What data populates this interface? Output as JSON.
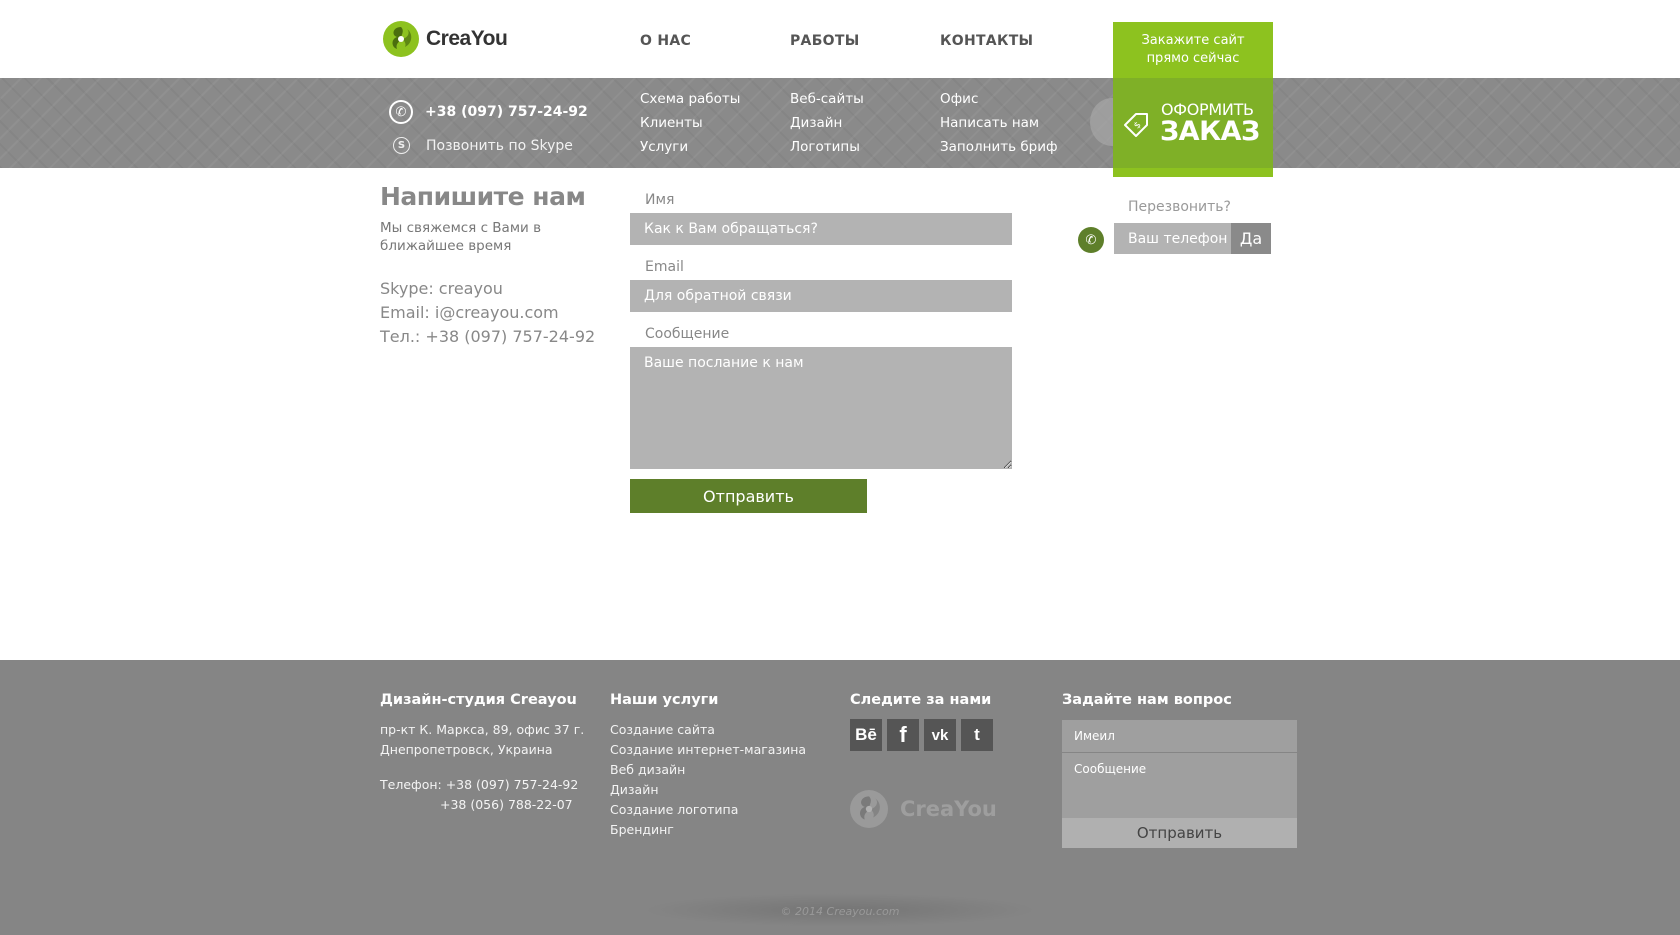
{
  "brand": {
    "name": "CreaYou"
  },
  "main_nav": [
    {
      "label": "О НАС"
    },
    {
      "label": "РАБОТЫ"
    },
    {
      "label": "КОНТАКТЫ"
    }
  ],
  "order_cta": {
    "top_line1": "Закажите сайт",
    "top_line2": "прямо сейчас",
    "line1": "ОФОРМИТЬ",
    "line2": "ЗАКАЗ",
    "accent": "#8dc21f"
  },
  "header_contacts": {
    "phone": "+38 (097) 757-24-92",
    "skype": "Позвонить по Skype"
  },
  "sub_nav": {
    "col1": [
      "Схема работы",
      "Клиенты",
      "Услуги"
    ],
    "col2": [
      "Веб-сайты",
      "Дизайн",
      "Логотипы"
    ],
    "col3": [
      "Офис",
      "Написать нам",
      "Заполнить бриф"
    ]
  },
  "contact": {
    "title": "Напишите нам",
    "subtitle": "Мы свяжемся с Вами в ближайшее время",
    "skype": "Skype: creayou",
    "email": "Email: i@creayou.com",
    "phone": "Тел.: +38 (097) 757-24-92"
  },
  "form": {
    "name_label": "Имя",
    "name_placeholder": "Как к Вам обращаться?",
    "email_label": "Email",
    "email_placeholder": "Для обратной связи",
    "message_label": "Сообщение",
    "message_placeholder": "Ваше послание к нам",
    "submit": "Отправить",
    "button_color": "#5e7f2a"
  },
  "callback": {
    "label": "Перезвонить?",
    "placeholder": "Ваш телефон",
    "button": "Да"
  },
  "footer": {
    "studio_title": "Дизайн-студия Creayou",
    "address1": "пр-кт К. Маркса, 89, офис 37 г.",
    "address2": "Днепропетровск, Украина",
    "phone1": "Телефон: +38 (097) 757-24-92",
    "phone2": "+38 (056) 788-22-07",
    "services_title": "Наши услуги",
    "services": [
      "Создание сайта",
      "Создание интернет-магазина",
      "Веб дизайн",
      "Дизайн",
      "Создание логотипа",
      "Брендинг"
    ],
    "follow_title": "Следите за нами",
    "social": [
      {
        "label": "Bē",
        "icon": "behance-icon"
      },
      {
        "label": "f",
        "icon": "facebook-icon"
      },
      {
        "label": "vk",
        "icon": "vk-icon"
      },
      {
        "label": "t",
        "icon": "twitter-icon"
      }
    ],
    "logo_text": "CreaYou",
    "question_title": "Задайте нам вопрос",
    "email_placeholder": "Имеил",
    "message_placeholder": "Сообщение",
    "submit": "Отправить",
    "copyright": "© 2014 Creayou.com"
  }
}
